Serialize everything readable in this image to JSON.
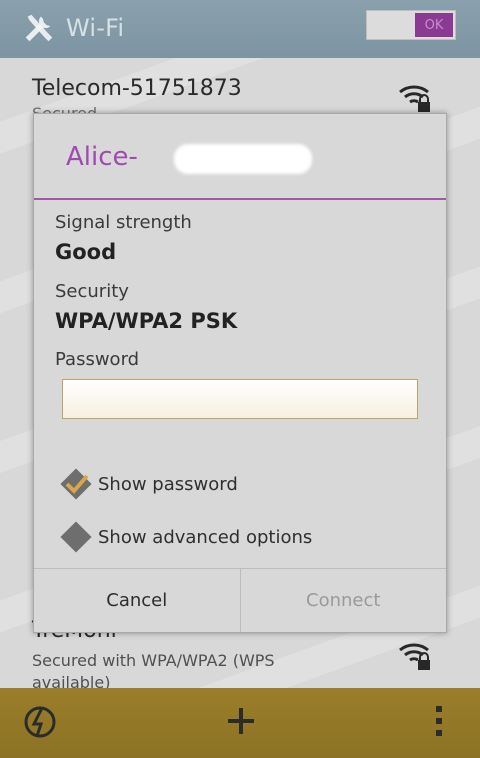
{
  "action_bar": {
    "title": "Wi-Fi",
    "toggle_label": "OK",
    "icon": "wrench-screwdriver-icon"
  },
  "network_list": {
    "top": {
      "name": "Telecom-51751873",
      "subtitle": "Secured",
      "icon": "wifi-locked-icon"
    },
    "bottom": {
      "name": "TreMoni",
      "subtitle": "Secured with WPA/WPA2 (WPS available)",
      "icon": "wifi-locked-icon"
    }
  },
  "dialog": {
    "title": "Alice-",
    "signal_label": "Signal strength",
    "signal_value": "Good",
    "security_label": "Security",
    "security_value": "WPA/WPA2 PSK",
    "password_label": "Password",
    "password_value": "",
    "show_password": {
      "label": "Show password",
      "checked": true
    },
    "show_advanced": {
      "label": "Show advanced options",
      "checked": false
    },
    "cancel_label": "Cancel",
    "connect_label": "Connect"
  },
  "bottom_bar": {
    "icons": [
      "wps-icon",
      "add-icon",
      "overflow-menu-icon"
    ]
  },
  "colors": {
    "accent": "#a04ab0",
    "action_bar": "#8aa0ad",
    "bottom_bar": "#9a7e2a",
    "checkbox_check": "#d9a64a"
  }
}
